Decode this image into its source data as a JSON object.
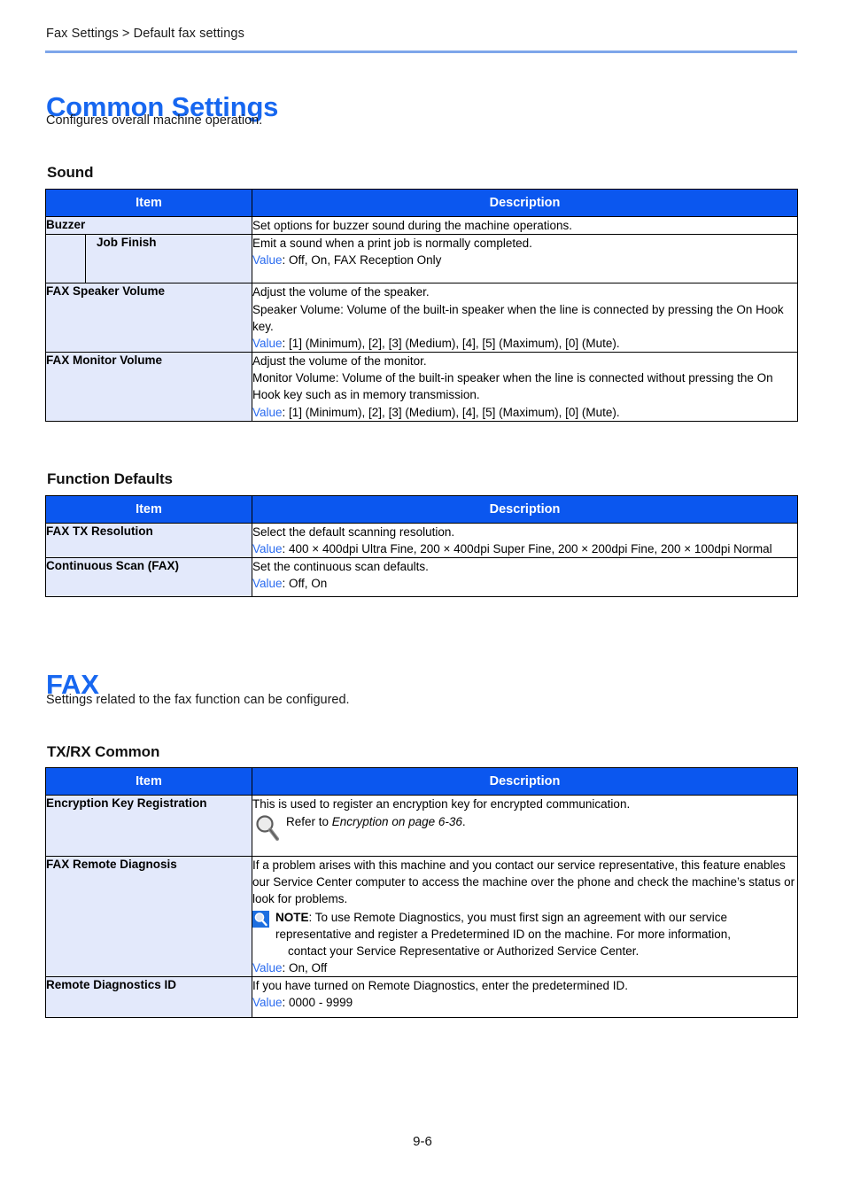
{
  "breadcrumb": "Fax Settings > Default fax settings",
  "sections": {
    "common": {
      "title": "Common Settings",
      "intro": "Configures overall machine operation.",
      "sound": {
        "heading": "Sound",
        "columns": {
          "item": "Item",
          "description": "Description"
        },
        "rows": [
          {
            "item": "Buzzer",
            "sub": false,
            "lines": [
              {
                "text": "Set options for buzzer sound during the machine operations."
              }
            ]
          },
          {
            "item": "Job Finish",
            "sub": true,
            "lines": [
              {
                "text": "Emit a sound when a print job is normally completed."
              },
              {
                "value_label": "Value",
                "text": ": Off, On, FAX Reception Only"
              }
            ]
          },
          {
            "item": "FAX Speaker Volume",
            "sub": false,
            "lines": [
              {
                "text": "Adjust the volume of the speaker."
              },
              {
                "text": "Speaker Volume: Volume of the built-in speaker when the line is connected by pressing the On Hook key."
              },
              {
                "value_label": "Value",
                "text": ": [1] (Minimum), [2], [3] (Medium), [4], [5] (Maximum), [0] (Mute)."
              }
            ]
          },
          {
            "item": "FAX Monitor Volume",
            "sub": false,
            "lines": [
              {
                "text": "Adjust the volume of the monitor."
              },
              {
                "text": "Monitor Volume: Volume of the built-in speaker when the line is connected without pressing the On Hook key such as in memory transmission."
              },
              {
                "value_label": "Value",
                "text": ": [1] (Minimum), [2], [3] (Medium), [4], [5] (Maximum), [0] (Mute)."
              }
            ]
          }
        ]
      },
      "function_defaults": {
        "heading": "Function Defaults",
        "columns": {
          "item": "Item",
          "description": "Description"
        },
        "rows": [
          {
            "item": "FAX TX Resolution",
            "lines": [
              {
                "text": "Select the default scanning resolution."
              },
              {
                "value_label": "Value",
                "text": ": 400 × 400dpi Ultra Fine, 200 × 400dpi Super Fine, 200 × 200dpi Fine, 200 × 100dpi Normal"
              }
            ]
          },
          {
            "item": "Continuous Scan (FAX)",
            "lines": [
              {
                "text": "Set the continuous scan defaults."
              },
              {
                "value_label": "Value",
                "text": ": Off, On"
              }
            ]
          }
        ]
      }
    },
    "fax": {
      "title": "FAX",
      "intro": "Settings related to the fax function can be configured.",
      "txrx": {
        "heading": "TX/RX Common",
        "columns": {
          "item": "Item",
          "description": "Description"
        },
        "rows": {
          "encryption": {
            "item": "Encryption Key Registration",
            "line1": "This is used to register an encryption key for encrypted communication.",
            "refer_prefix": "Refer to ",
            "refer_italic": "Encryption on page 6-36",
            "refer_suffix": ".",
            "icon": "magnifier-icon"
          },
          "remote_diagnosis": {
            "item": "FAX Remote Diagnosis",
            "line1": "If a problem arises with this machine and you contact our service representative, this feature enables our Service Center computer to access the machine over the phone and check the machine’s status or look for problems.",
            "note_icon": "note-magnifier-icon",
            "note_label": "NOTE",
            "note_text": ": To use Remote Diagnostics, you must first sign an agreement with our service representative and register a Predetermined ID on the machine. For more information,",
            "note_text2": "contact your Service Representative or Authorized Service Center.",
            "value_label": "Value",
            "value_text": ": On, Off"
          },
          "remote_id": {
            "item": "Remote Diagnostics ID",
            "line1": "If you have turned on Remote Diagnostics, enter the predetermined ID.",
            "value_label": "Value",
            "value_text": ": 0000 - 9999"
          }
        }
      }
    }
  },
  "footer": {
    "page_number": "9-6"
  },
  "colors": {
    "heading_blue": "#1767F0",
    "table_header_blue": "#0B57EF",
    "item_cell_bg": "#E3E9FB",
    "value_blue": "#2A6BEF",
    "rule_blue": "#7EA6EA"
  }
}
